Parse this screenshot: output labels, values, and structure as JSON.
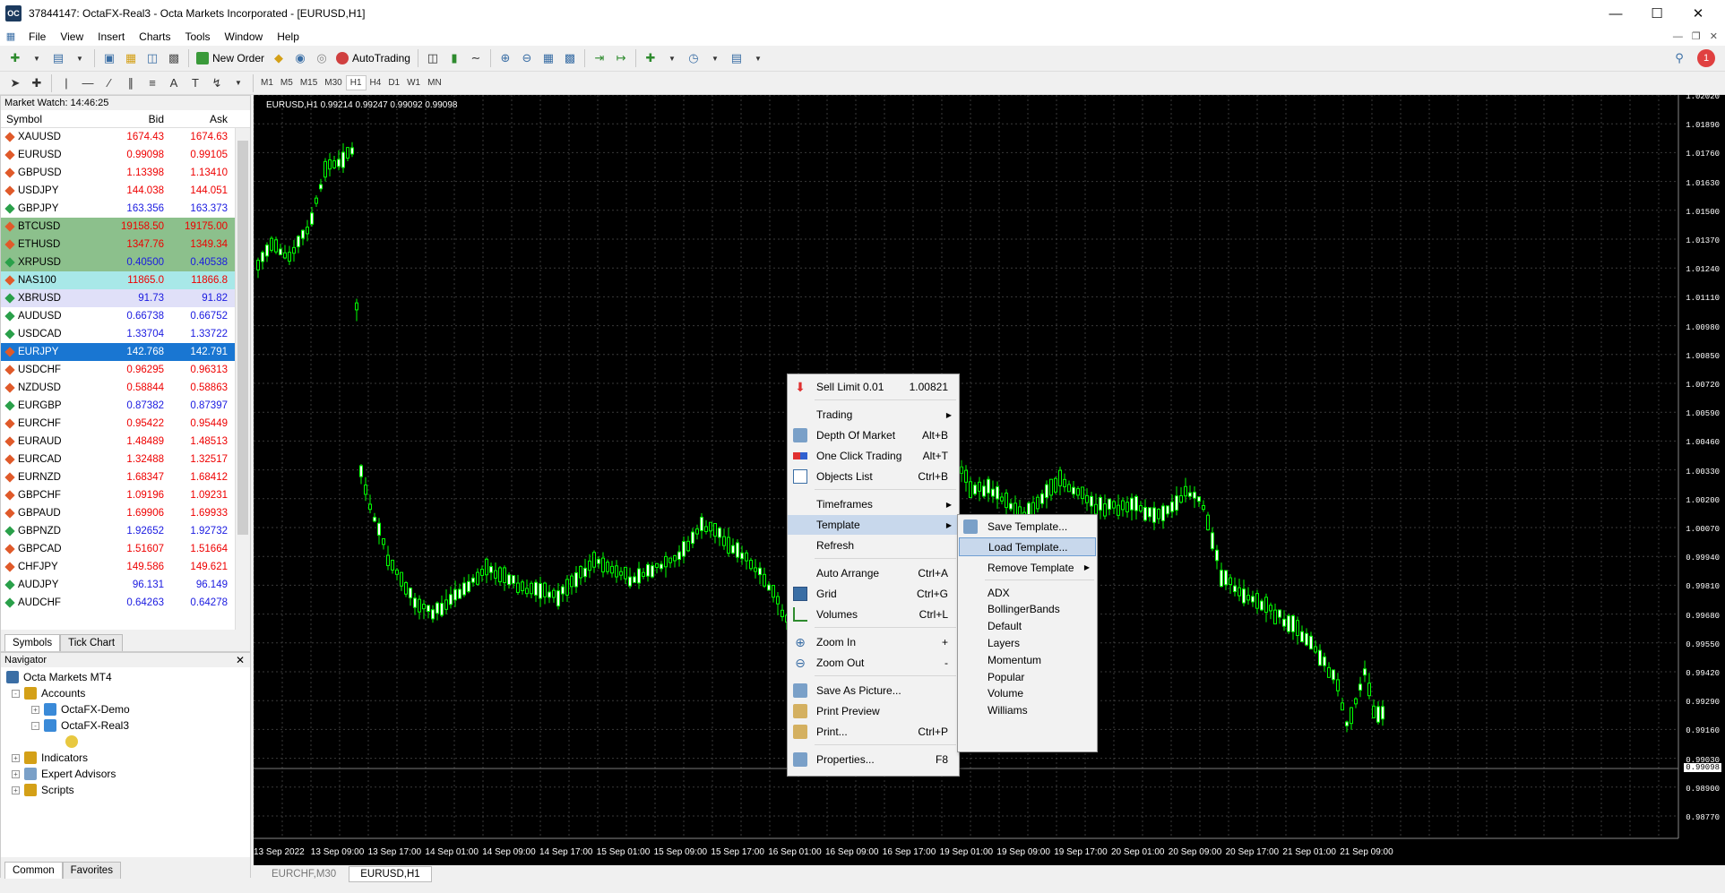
{
  "window": {
    "title": "37844147: OctaFX-Real3 - Octa Markets Incorporated - [EURUSD,H1]",
    "app_icon": "OC"
  },
  "menu": [
    "File",
    "View",
    "Insert",
    "Charts",
    "Tools",
    "Window",
    "Help"
  ],
  "toolbar": {
    "new_order": "New Order",
    "autotrading": "AutoTrading",
    "notifications_count": "1"
  },
  "timeframes": [
    "M1",
    "M5",
    "M15",
    "M30",
    "H1",
    "H4",
    "D1",
    "W1",
    "MN"
  ],
  "market_watch": {
    "title": "Market Watch: 14:46:25",
    "headers": {
      "symbol": "Symbol",
      "bid": "Bid",
      "ask": "Ask"
    },
    "rows": [
      {
        "symbol": "XAUUSD",
        "bid": "1674.43",
        "ask": "1674.63",
        "dir": "down",
        "style": ""
      },
      {
        "symbol": "EURUSD",
        "bid": "0.99098",
        "ask": "0.99105",
        "dir": "down",
        "style": ""
      },
      {
        "symbol": "GBPUSD",
        "bid": "1.13398",
        "ask": "1.13410",
        "dir": "down",
        "style": ""
      },
      {
        "symbol": "USDJPY",
        "bid": "144.038",
        "ask": "144.051",
        "dir": "down",
        "style": ""
      },
      {
        "symbol": "GBPJPY",
        "bid": "163.356",
        "ask": "163.373",
        "dir": "up",
        "style": ""
      },
      {
        "symbol": "BTCUSD",
        "bid": "19158.50",
        "ask": "19175.00",
        "dir": "down",
        "style": "green"
      },
      {
        "symbol": "ETHUSD",
        "bid": "1347.76",
        "ask": "1349.34",
        "dir": "down",
        "style": "green"
      },
      {
        "symbol": "XRPUSD",
        "bid": "0.40500",
        "ask": "0.40538",
        "dir": "up",
        "style": "green"
      },
      {
        "symbol": "NAS100",
        "bid": "11865.0",
        "ask": "11866.8",
        "dir": "down",
        "style": "cyan"
      },
      {
        "symbol": "XBRUSD",
        "bid": "91.73",
        "ask": "91.82",
        "dir": "up",
        "style": "lav"
      },
      {
        "symbol": "AUDUSD",
        "bid": "0.66738",
        "ask": "0.66752",
        "dir": "up",
        "style": ""
      },
      {
        "symbol": "USDCAD",
        "bid": "1.33704",
        "ask": "1.33722",
        "dir": "up",
        "style": ""
      },
      {
        "symbol": "EURJPY",
        "bid": "142.768",
        "ask": "142.791",
        "dir": "down",
        "style": "sel"
      },
      {
        "symbol": "USDCHF",
        "bid": "0.96295",
        "ask": "0.96313",
        "dir": "down",
        "style": ""
      },
      {
        "symbol": "NZDUSD",
        "bid": "0.58844",
        "ask": "0.58863",
        "dir": "down",
        "style": ""
      },
      {
        "symbol": "EURGBP",
        "bid": "0.87382",
        "ask": "0.87397",
        "dir": "up",
        "style": ""
      },
      {
        "symbol": "EURCHF",
        "bid": "0.95422",
        "ask": "0.95449",
        "dir": "down",
        "style": ""
      },
      {
        "symbol": "EURAUD",
        "bid": "1.48489",
        "ask": "1.48513",
        "dir": "down",
        "style": ""
      },
      {
        "symbol": "EURCAD",
        "bid": "1.32488",
        "ask": "1.32517",
        "dir": "down",
        "style": ""
      },
      {
        "symbol": "EURNZD",
        "bid": "1.68347",
        "ask": "1.68412",
        "dir": "down",
        "style": ""
      },
      {
        "symbol": "GBPCHF",
        "bid": "1.09196",
        "ask": "1.09231",
        "dir": "down",
        "style": ""
      },
      {
        "symbol": "GBPAUD",
        "bid": "1.69906",
        "ask": "1.69933",
        "dir": "down",
        "style": ""
      },
      {
        "symbol": "GBPNZD",
        "bid": "1.92652",
        "ask": "1.92732",
        "dir": "up",
        "style": ""
      },
      {
        "symbol": "GBPCAD",
        "bid": "1.51607",
        "ask": "1.51664",
        "dir": "down",
        "style": ""
      },
      {
        "symbol": "CHFJPY",
        "bid": "149.586",
        "ask": "149.621",
        "dir": "down",
        "style": ""
      },
      {
        "symbol": "AUDJPY",
        "bid": "96.131",
        "ask": "96.149",
        "dir": "up",
        "style": ""
      },
      {
        "symbol": "AUDCHF",
        "bid": "0.64263",
        "ask": "0.64278",
        "dir": "up",
        "style": ""
      }
    ],
    "tabs": [
      "Symbols",
      "Tick Chart"
    ]
  },
  "navigator": {
    "title": "Navigator",
    "root": "Octa Markets MT4",
    "accounts": "Accounts",
    "account1": "OctaFX-Demo",
    "account2": "OctaFX-Real3",
    "indicators": "Indicators",
    "experts": "Expert Advisors",
    "scripts": "Scripts",
    "tabs": [
      "Common",
      "Favorites"
    ]
  },
  "chart": {
    "label": "EURUSD,H1  0.99214 0.99247 0.99092 0.99098",
    "current_price": "0.99098",
    "price_labels": [
      "1.02020",
      "1.01890",
      "1.01760",
      "1.01630",
      "1.01500",
      "1.01370",
      "1.01240",
      "1.01110",
      "1.00980",
      "1.00850",
      "1.00720",
      "1.00590",
      "1.00460",
      "1.00330",
      "1.00200",
      "1.00070",
      "0.99940",
      "0.99810",
      "0.99680",
      "0.99550",
      "0.99420",
      "0.99290",
      "0.99160",
      "0.99030",
      "0.98900",
      "0.98770"
    ],
    "time_labels": [
      "13 Sep 2022",
      "13 Sep 09:00",
      "13 Sep 17:00",
      "14 Sep 01:00",
      "14 Sep 09:00",
      "14 Sep 17:00",
      "15 Sep 01:00",
      "15 Sep 09:00",
      "15 Sep 17:00",
      "16 Sep 01:00",
      "16 Sep 09:00",
      "16 Sep 17:00",
      "19 Sep 01:00",
      "19 Sep 09:00",
      "19 Sep 17:00",
      "20 Sep 01:00",
      "20 Sep 09:00",
      "20 Sep 17:00",
      "21 Sep 01:00",
      "21 Sep 09:00"
    ],
    "tabs": [
      "EURCHF,M30",
      "EURUSD,H1"
    ],
    "up_color": "#00ff00",
    "bg_color": "#000000"
  },
  "context_menu": {
    "sell_limit": "Sell Limit 0.01",
    "sell_limit_price": "1.00821",
    "trading": "Trading",
    "depth": "Depth Of Market",
    "depth_sc": "Alt+B",
    "oneclick": "One Click Trading",
    "oneclick_sc": "Alt+T",
    "objects": "Objects List",
    "objects_sc": "Ctrl+B",
    "timeframes": "Timeframes",
    "template": "Template",
    "refresh": "Refresh",
    "autoarrange": "Auto Arrange",
    "autoarrange_sc": "Ctrl+A",
    "grid": "Grid",
    "grid_sc": "Ctrl+G",
    "volumes": "Volumes",
    "volumes_sc": "Ctrl+L",
    "zoomin": "Zoom In",
    "zoomin_sc": "+",
    "zoomout": "Zoom Out",
    "zoomout_sc": "-",
    "saveaspic": "Save As Picture...",
    "printpreview": "Print Preview",
    "print": "Print...",
    "print_sc": "Ctrl+P",
    "properties": "Properties...",
    "properties_sc": "F8"
  },
  "template_submenu": {
    "save": "Save Template...",
    "load": "Load Template...",
    "remove": "Remove Template",
    "items": [
      "ADX",
      "BollingerBands",
      "Default",
      "Layers",
      "Momentum",
      "Popular",
      "Volume",
      "Williams"
    ]
  }
}
